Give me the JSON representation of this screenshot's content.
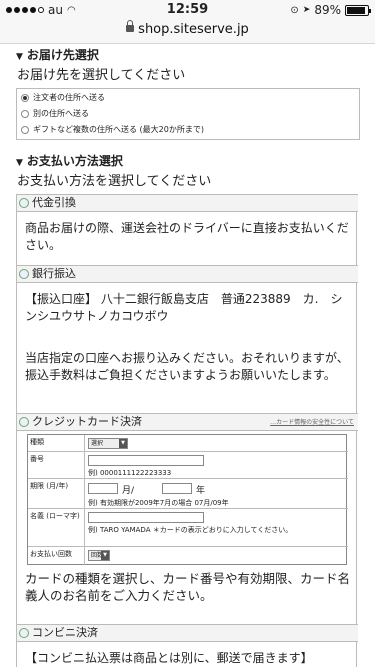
{
  "status_bar": {
    "carrier": "au",
    "time": "12:59",
    "battery": "89%",
    "battery_fraction": 0.89
  },
  "url_bar": {
    "domain": "shop.siteserve.jp"
  },
  "delivery": {
    "title": "お届け先選択",
    "subtitle": "お届け先を選択してください",
    "options": [
      "注文者の住所へ送る",
      "別の住所へ送る",
      "ギフトなど複数の住所へ送る (最大20か所まで)"
    ],
    "selected_index": 0
  },
  "payment": {
    "title": "お支払い方法選択",
    "subtitle": "お支払い方法を選択してください",
    "cod": {
      "name": "代金引換",
      "desc": "商品お届けの際、運送会社のドライバーに直接お支払いください。"
    },
    "bank": {
      "name": "銀行振込",
      "account": "【振込口座】 八十二銀行飯島支店　普通223889　カ.　シンシユウサトノカコウボウ",
      "desc": "当店指定の口座へお振り込みください。おそれいりますが、振込手数料はご負担くださいますようお願いいたします。"
    },
    "card": {
      "name": "クレジットカード決済",
      "security_note": "…カード情報の安全性について",
      "type_label": "種類",
      "type_value": "選択",
      "number_label": "番号",
      "number_example": "例) 0000111122223333",
      "expiry_label": "期限 (月/年)",
      "month_unit": "月/",
      "year_unit": "年",
      "expiry_example": "例) 有効期限が2009年7月の場合 07月/09年",
      "name_label": "名義 (ローマ字)",
      "name_example": "例) TARO YAMADA ＊カードの表示どおりに入力してください。",
      "installments_label": "お支払い回数",
      "installments_value": "回数",
      "desc": "カードの種類を選択し、カード番号や有効期限、カード名義人のお名前をご入力ください。"
    },
    "convenience": {
      "name": "コンビニ決済",
      "desc": "【コンビニ払込票は商品とは別に、郵送で届きます】"
    }
  }
}
